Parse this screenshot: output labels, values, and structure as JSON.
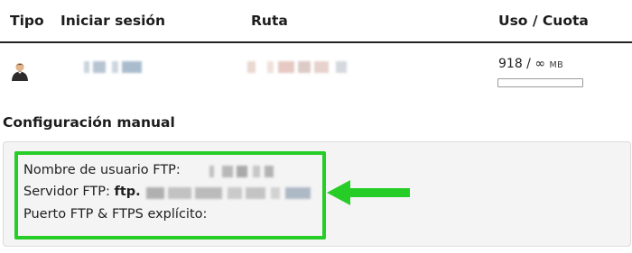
{
  "table": {
    "headers": {
      "tipo": "Tipo",
      "login": "Iniciar sesión",
      "ruta": "Ruta",
      "uso": "Uso / Cuota"
    },
    "row": {
      "type_icon": "user-avatar-icon",
      "usage_value": "918 / ∞",
      "usage_unit": "MB",
      "usage_fraction": 0
    }
  },
  "manual_config": {
    "title": "Configuración manual",
    "ftp_username_label": "Nombre de usuario FTP:",
    "ftp_server_label": "Servidor FTP:",
    "ftp_server_value_prefix": "ftp.",
    "ftp_port_label": "Puerto FTP & FTPS explícito:"
  },
  "colors": {
    "highlight": "#27cd27",
    "panel_bg": "#f4f4f4"
  }
}
